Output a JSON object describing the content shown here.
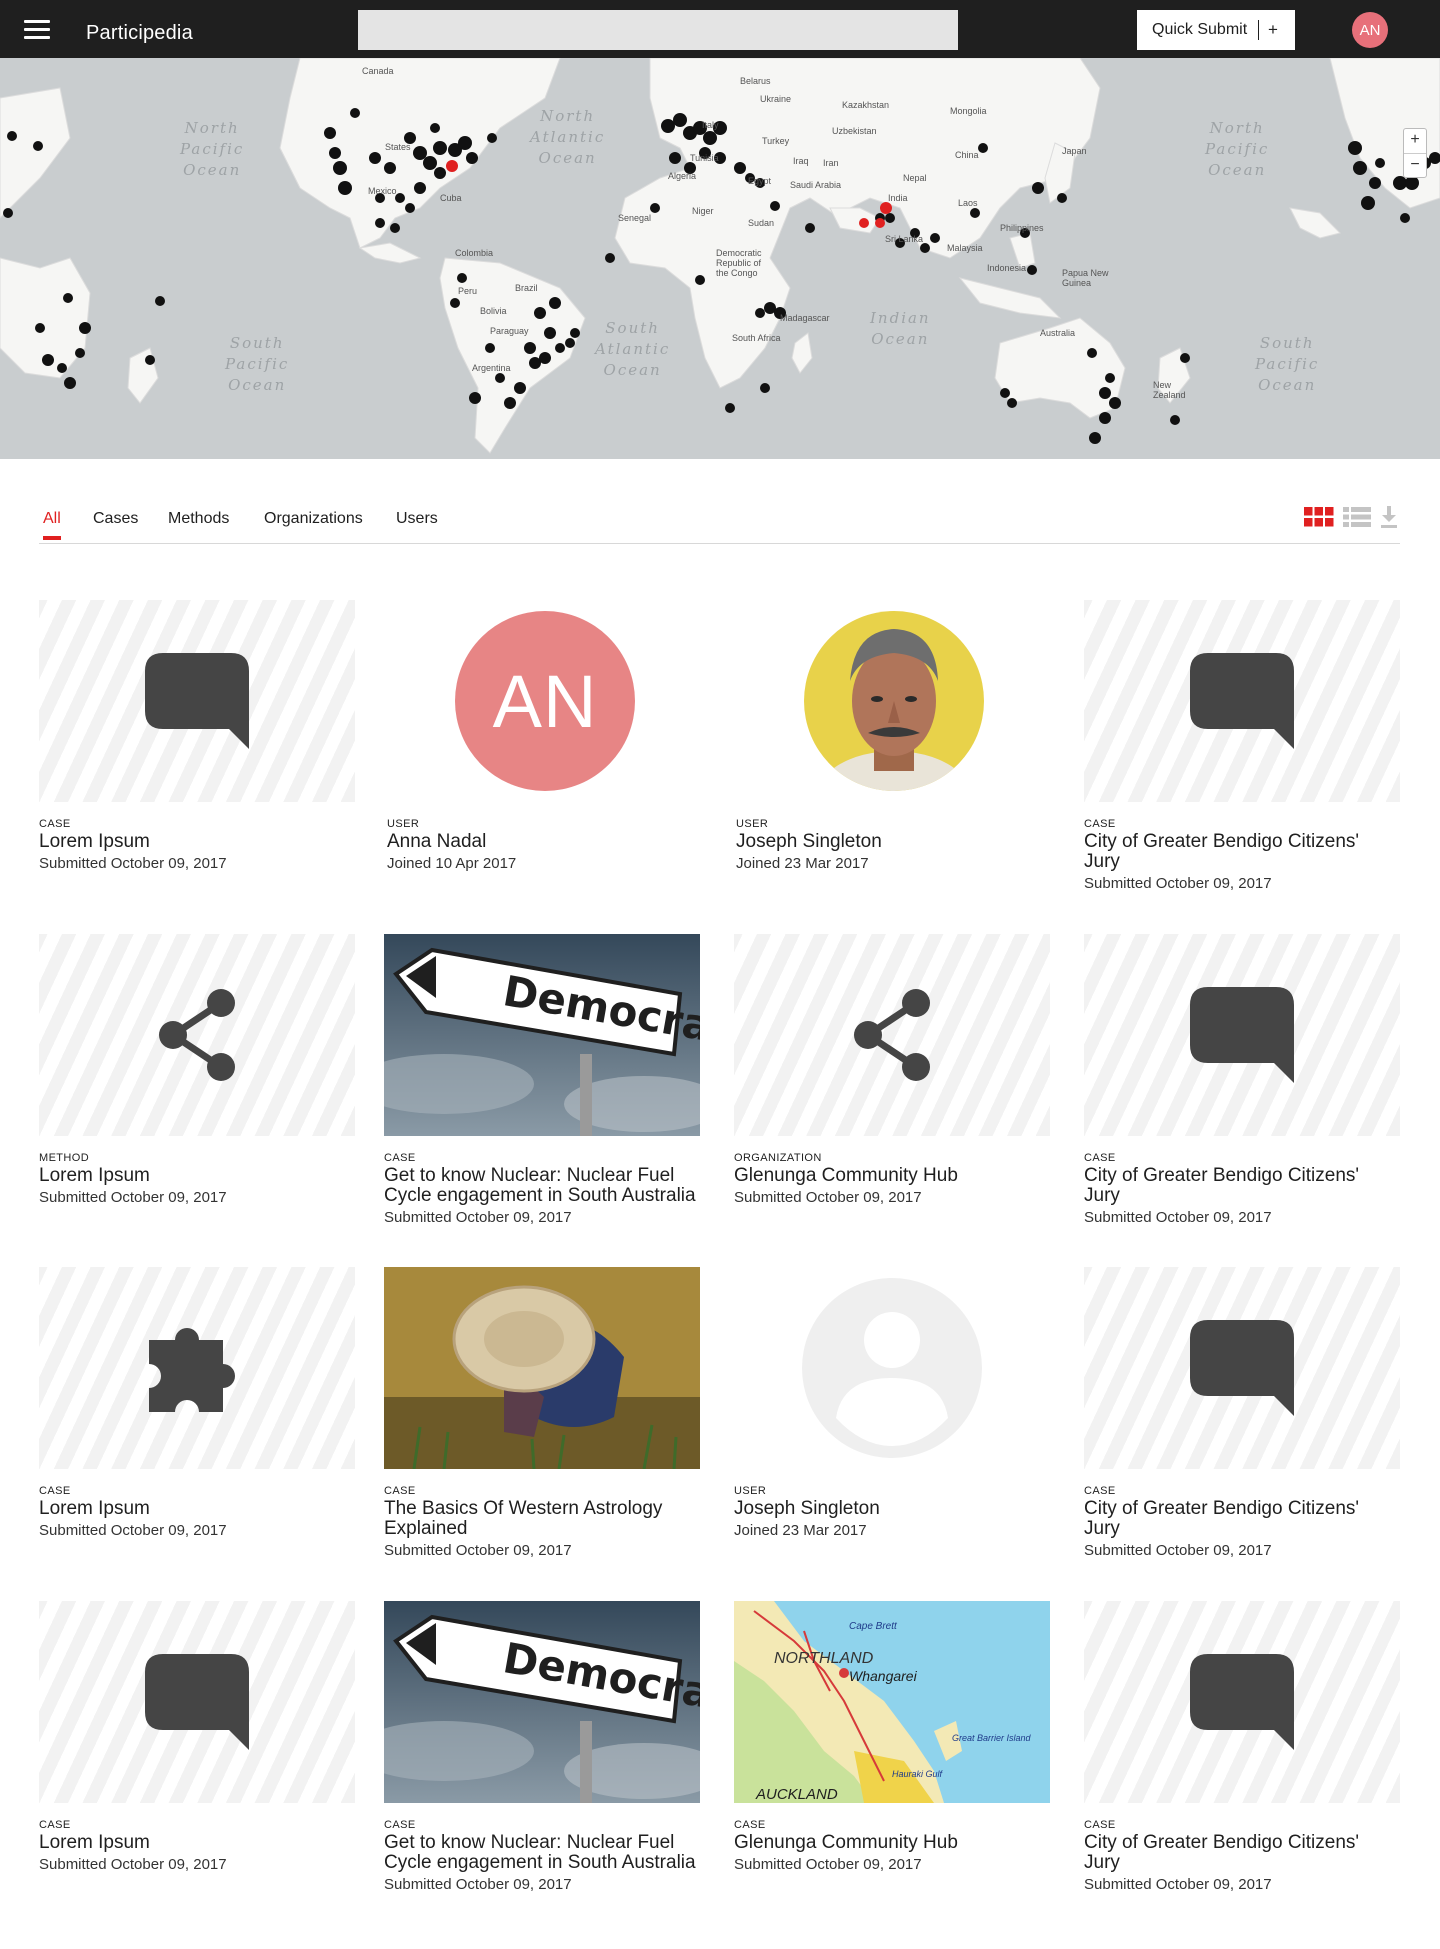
{
  "header": {
    "brand": "Participedia",
    "search_placeholder": "",
    "quick_submit_label": "Quick Submit",
    "quick_submit_plus": "+",
    "avatar_initials": "AN"
  },
  "map": {
    "ocean_labels": [
      "North Pacific Ocean",
      "North Atlantic Ocean",
      "North Pacific Ocean",
      "South Pacific Ocean",
      "South Atlantic Ocean",
      "Indian Ocean",
      "South Pacific Ocean"
    ],
    "country_labels": [
      "Canada",
      "States",
      "Mexico",
      "Cuba",
      "Colombia",
      "Peru",
      "Bolivia",
      "Brazil",
      "Paraguay",
      "Argentina",
      "Belarus",
      "Ukraine",
      "Italy",
      "Turkey",
      "Tunisia",
      "Algeria",
      "Egypt",
      "Iraq",
      "Iran",
      "Saudi Arabia",
      "Senegal",
      "Niger",
      "Sudan",
      "Democratic Republic of the Congo",
      "Madagascar",
      "South Africa",
      "Kazakhstan",
      "Uzbekistan",
      "Mongolia",
      "China",
      "Nepal",
      "India",
      "Sri Lanka",
      "Laos",
      "Malaysia",
      "Indonesia",
      "Philippines",
      "Japan",
      "Papua New Guinea",
      "Australia",
      "New Zealand"
    ],
    "zoom_in": "+",
    "zoom_out": "−"
  },
  "tabs": [
    {
      "label": "All",
      "active": true
    },
    {
      "label": "Cases",
      "active": false
    },
    {
      "label": "Methods",
      "active": false
    },
    {
      "label": "Organizations",
      "active": false
    },
    {
      "label": "Users",
      "active": false
    }
  ],
  "view_controls": {
    "grid": "grid-view-icon",
    "list": "list-view-icon",
    "download": "download-icon"
  },
  "accent_color": "#e02020",
  "cards": [
    {
      "type": "CASE",
      "title": "Lorem Ipsum",
      "meta": "Submitted October 09, 2017",
      "media": "chat-bubble-icon"
    },
    {
      "type": "USER",
      "title": "Anna Nadal",
      "meta": "Joined 10 Apr 2017",
      "media": "initials",
      "initials": "AN"
    },
    {
      "type": "USER",
      "title": "Joseph Singleton",
      "meta": "Joined 23 Mar 2017",
      "media": "photo-portrait"
    },
    {
      "type": "CASE",
      "title": "City of Greater Bendigo Citizens' Jury",
      "meta": "Submitted October 09, 2017",
      "media": "chat-bubble-icon"
    },
    {
      "type": "METHOD",
      "title": "Lorem Ipsum",
      "meta": "Submitted October 09, 2017",
      "media": "share-icon"
    },
    {
      "type": "CASE",
      "title": "Get to know Nuclear: Nuclear Fuel Cycle engagement in South Australia",
      "meta": "Submitted October 09, 2017",
      "media": "photo-democracy-sign",
      "sign_text": "Democracy"
    },
    {
      "type": "ORGANIZATION",
      "title": "Glenunga Community Hub",
      "meta": "Submitted October 09, 2017",
      "media": "share-icon"
    },
    {
      "type": "CASE",
      "title": "City of Greater Bendigo Citizens' Jury",
      "meta": "Submitted October 09, 2017",
      "media": "chat-bubble-icon"
    },
    {
      "type": "CASE",
      "title": "Lorem Ipsum",
      "meta": "Submitted October 09, 2017",
      "media": "puzzle-icon"
    },
    {
      "type": "CASE",
      "title": "The Basics Of Western Astrology Explained",
      "meta": "Submitted October 09, 2017",
      "media": "photo-rice-farmer"
    },
    {
      "type": "USER",
      "title": "Joseph Singleton",
      "meta": "Joined 23 Mar 2017",
      "media": "default-user-icon"
    },
    {
      "type": "CASE",
      "title": "City of Greater Bendigo Citizens' Jury",
      "meta": "Submitted October 09, 2017",
      "media": "chat-bubble-icon"
    },
    {
      "type": "CASE",
      "title": "Lorem Ipsum",
      "meta": "Submitted October 09, 2017",
      "media": "chat-bubble-icon"
    },
    {
      "type": "CASE",
      "title": "Get to know Nuclear: Nuclear Fuel Cycle engagement in South Australia",
      "meta": "Submitted October 09, 2017",
      "media": "photo-democracy-sign",
      "sign_text": "Democracy"
    },
    {
      "type": "CASE",
      "title": "Glenunga Community Hub",
      "meta": "Submitted October 09, 2017",
      "media": "photo-northland-map",
      "map_labels": [
        "Cape Brett",
        "NORTHLAND",
        "Whangarei",
        "Great Barrier Island",
        "AUCKLAND",
        "Hauraki Gulf"
      ]
    },
    {
      "type": "CASE",
      "title": "City of Greater Bendigo Citizens' Jury",
      "meta": "Submitted October 09, 2017",
      "media": "chat-bubble-icon"
    }
  ]
}
